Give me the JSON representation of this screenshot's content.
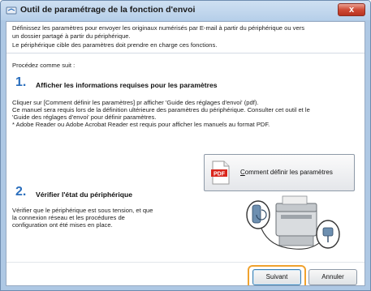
{
  "window": {
    "title": "Outil de paramétrage de la fonction d'envoi",
    "close_label": "x"
  },
  "intro": {
    "lines": [
      "Définissez les paramètres pour envoyer les originaux numérisés par E-mail à partir du périphérique ou vers",
      "un dossier partagé à partir du périphérique.",
      "Le périphérique cible des paramètres doit prendre en charge ces fonctions."
    ]
  },
  "procedure": {
    "label": "Procédez comme suit :"
  },
  "step1": {
    "number": "1.",
    "title": "Afficher les informations requises pour les paramètres",
    "lines": [
      "Cliquer sur [Comment définir les paramètres] pr afficher 'Guide des réglages d'envoi' (pdf).",
      "Ce manuel sera requis lors de la définition ultérieure des paramètres du périphérique. Consulter cet outil et le",
      "'Guide des réglages d'envoi' pour définir paramètres.",
      "* Adobe Reader ou Adobe Acrobat Reader est requis pour afficher les manuels au format PDF."
    ],
    "button": {
      "icon_text": "PDF",
      "label_accel": "C",
      "label_rest": "omment définir les paramètres"
    }
  },
  "step2": {
    "number": "2.",
    "title": "Vérifier l'état du périphérique",
    "lines": [
      "Vérifier que le périphérique est sous tension, et que",
      "la connexion réseau et les procédures de",
      "configuration ont été mises en place."
    ]
  },
  "footer": {
    "next_label": "Suivant",
    "cancel_label": "Annuler"
  },
  "colors": {
    "titlebar": "#b6cfe9",
    "step_number": "#2a6ebd",
    "highlight": "#f0a22e",
    "close": "#cf4b36"
  },
  "icons": {
    "title": "app-icon",
    "pdf": "pdf-file-icon",
    "device": "multifunction-printer-illustration"
  }
}
